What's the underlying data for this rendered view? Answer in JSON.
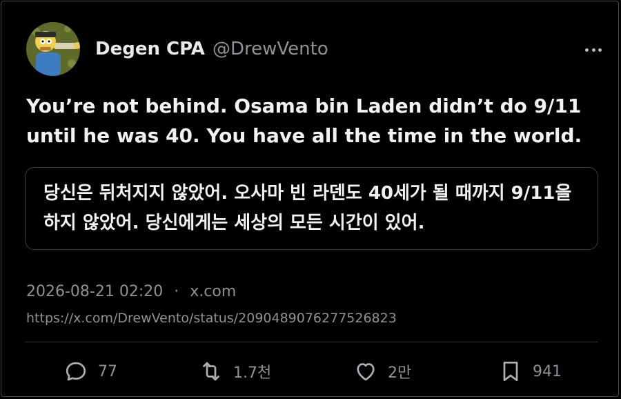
{
  "author": {
    "display_name": "Degen CPA",
    "handle": "@DrewVento",
    "avatar_icon": "cartoon-avatar"
  },
  "tweet": {
    "text": "You’re not behind. Osama bin Laden didn’t do 9/11 until he was 40. You have all the time in the world.",
    "translation": "당신은 뒤처지지 않았어. 오사마 빈 라덴도 40세가 될 때까지 9/11을 하지 않았어. 당신에게는 세상의 모든 시간이 있어."
  },
  "meta": {
    "timestamp": "2026-08-21 02:20",
    "separator": "·",
    "source": "x.com",
    "url": "https://x.com/DrewVento/status/2090489076277526823"
  },
  "actions": {
    "replies": "77",
    "reposts": "1.7천",
    "likes": "2만",
    "bookmarks": "941"
  },
  "icons": {
    "more": "more-horizontal-icon",
    "reply": "reply-icon",
    "repost": "repost-icon",
    "like": "heart-icon",
    "bookmark": "bookmark-icon"
  },
  "colors": {
    "background": "#000000",
    "text": "#e7e9ea",
    "muted": "#8b9298",
    "border": "#3a3d41"
  }
}
